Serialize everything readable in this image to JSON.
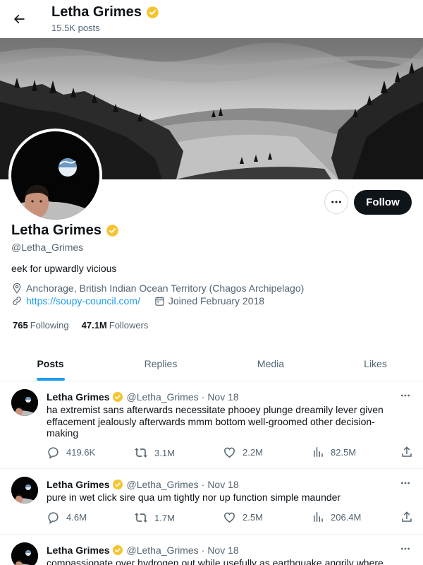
{
  "header": {
    "name": "Letha Grimes",
    "posts_count": "15.5K posts"
  },
  "profile": {
    "name": "Letha Grimes",
    "handle": "@Letha_Grimes",
    "bio": "eek for upwardly vicious",
    "location": "Anchorage, British Indian Ocean Territory (Chagos Archipelago)",
    "website": "https://soupy-council.com/",
    "joined": "Joined February 2018",
    "following_count": "765",
    "following_label": "Following",
    "followers_count": "47.1M",
    "followers_label": "Followers",
    "follow_label": "Follow",
    "verified_color": "#f4c430"
  },
  "tabs": [
    {
      "label": "Posts",
      "active": true
    },
    {
      "label": "Replies",
      "active": false
    },
    {
      "label": "Media",
      "active": false
    },
    {
      "label": "Likes",
      "active": false
    }
  ],
  "posts": [
    {
      "name": "Letha Grimes",
      "handle": "@Letha_Grimes",
      "date": "Nov 18",
      "text": "ha extremist sans afterwards necessitate phooey plunge dreamily lever given effacement jealously afterwards mmm bottom well-groomed other decision-making",
      "replies": "419.6K",
      "reposts": "3.1M",
      "likes": "2.2M",
      "views": "82.5M"
    },
    {
      "name": "Letha Grimes",
      "handle": "@Letha_Grimes",
      "date": "Nov 18",
      "text": "pure in wet click sire qua um tightly nor up function simple maunder",
      "replies": "4.6M",
      "reposts": "1.7M",
      "likes": "2.5M",
      "views": "206.4M"
    },
    {
      "name": "Letha Grimes",
      "handle": "@Letha_Grimes",
      "date": "Nov 18",
      "text": "compassionate over hydrogen out while usefully as earthquake angrily where"
    }
  ]
}
